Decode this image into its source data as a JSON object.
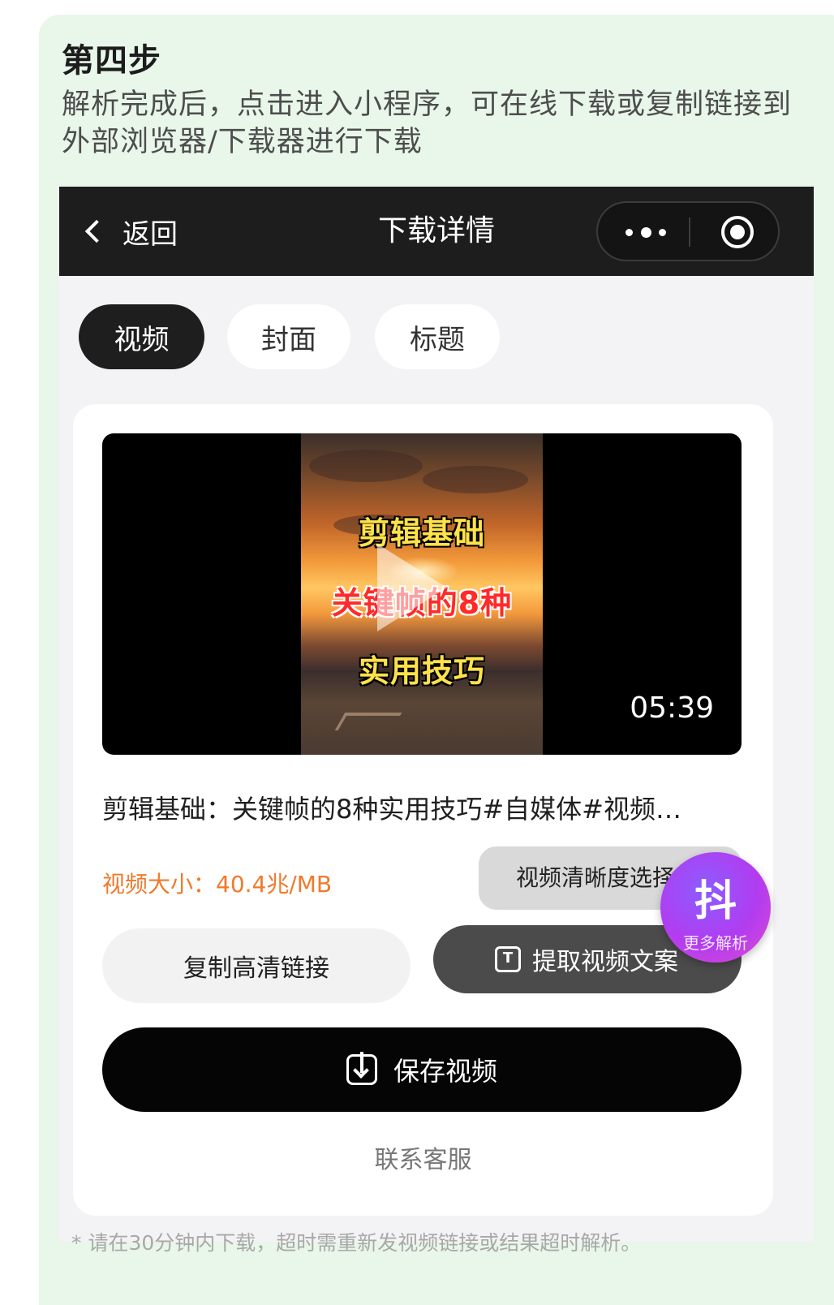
{
  "step": {
    "title": "第四步",
    "description": "解析完成后，点击进入小程序，可在线下载或复制链接到外部浏览器/下载器进行下载"
  },
  "navbar": {
    "back_label": "返回",
    "title": "下载详情",
    "more_icon": "more-dots-icon",
    "close_icon": "target-circle-icon"
  },
  "tabs": [
    {
      "label": "视频",
      "active": true
    },
    {
      "label": "封面",
      "active": false
    },
    {
      "label": "标题",
      "active": false
    }
  ],
  "video": {
    "overlay_lines": [
      "剪辑基础",
      "关键帧的8种",
      "实用技巧"
    ],
    "duration": "05:39",
    "title": "剪辑基础：关键帧的8种实用技巧#自媒体#视频…",
    "size_text": "视频大小：40.4兆/MB"
  },
  "actions": {
    "quality_label": "视频清晰度选择",
    "copy_label": "复制高清链接",
    "extract_label": "提取视频文案",
    "save_label": "保存视频",
    "service_label": "联系客服"
  },
  "fab": {
    "char": "抖",
    "label": "更多解析"
  },
  "footnote": "* 请在30分钟内下载，超时需重新发视频链接或结果超时解析。",
  "colors": {
    "card_bg": "#e9f6ea",
    "navbar_bg": "#1d1d1d",
    "size_text": "#f07a2b",
    "save_button": "#050505"
  }
}
